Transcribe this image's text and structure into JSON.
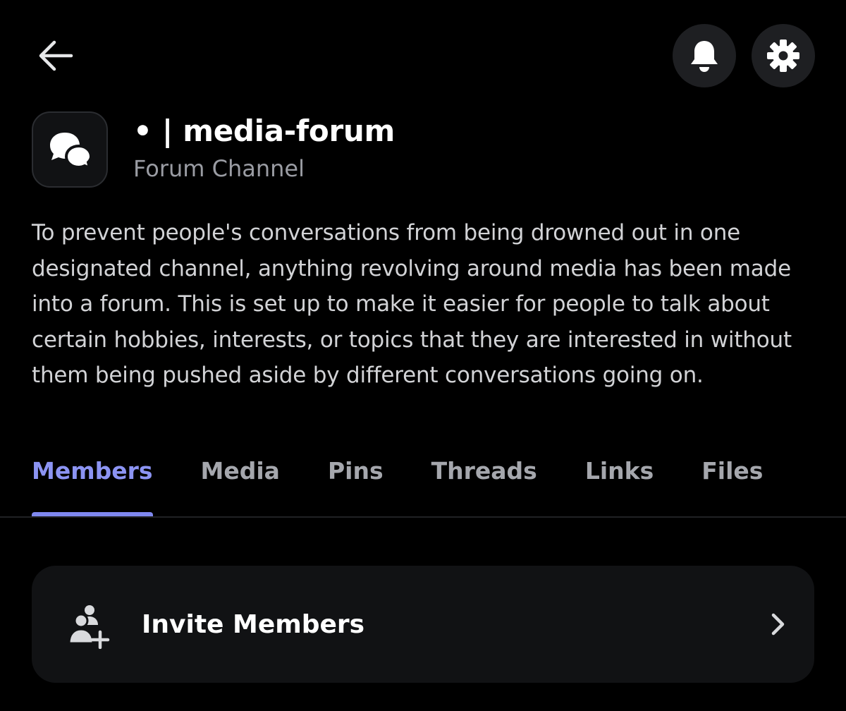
{
  "header": {
    "back_icon": "arrow-left-icon",
    "actions": [
      {
        "name": "notifications",
        "icon": "bell-icon"
      },
      {
        "name": "settings",
        "icon": "gear-icon"
      }
    ]
  },
  "channel": {
    "icon": "forum-bubbles-icon",
    "name": "• | media-forum",
    "type": "Forum Channel",
    "description": "To prevent people's conversations from being drowned out in one designated channel, anything revolving around media has been made into a forum. This is set up to make it easier for people to talk about certain hobbies, interests, or topics that they are interested in without them being pushed aside by different conversations going on."
  },
  "tabs": [
    {
      "label": "Members",
      "active": true
    },
    {
      "label": "Media",
      "active": false
    },
    {
      "label": "Pins",
      "active": false
    },
    {
      "label": "Threads",
      "active": false
    },
    {
      "label": "Links",
      "active": false
    },
    {
      "label": "Files",
      "active": false
    }
  ],
  "invite": {
    "label": "Invite Members",
    "icon": "add-user-icon",
    "chevron": "chevron-right-icon"
  },
  "colors": {
    "background": "#000000",
    "card": "#111214",
    "accent": "#7f88ef",
    "accent_text": "#8c94f3",
    "muted_text": "#a5a7ad"
  }
}
